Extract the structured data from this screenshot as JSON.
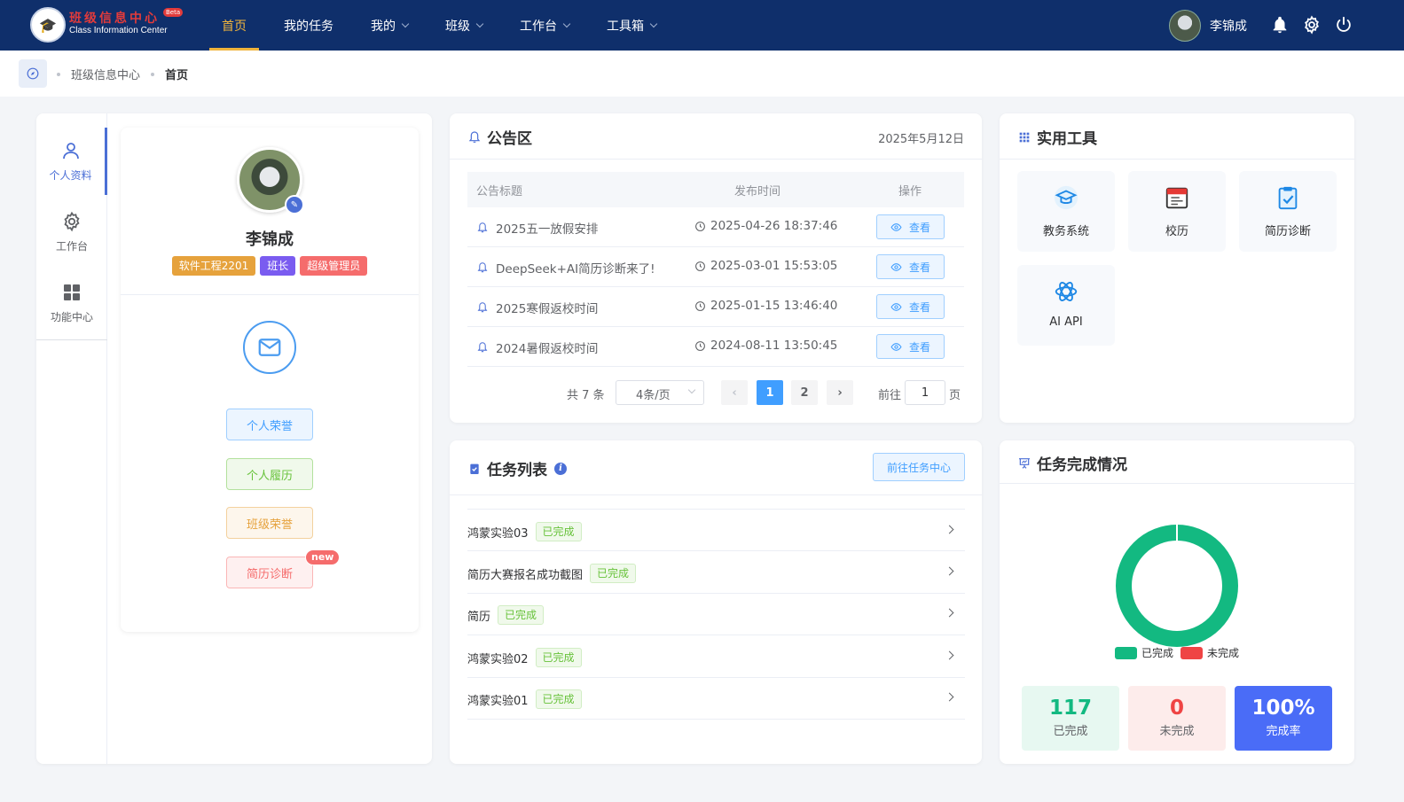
{
  "brand": {
    "cn": "班级信息中心",
    "en": "Class Information Center",
    "badge": "Beta"
  },
  "nav": [
    {
      "label": "首页",
      "active": true,
      "dropdown": false
    },
    {
      "label": "我的任务",
      "active": false,
      "dropdown": false
    },
    {
      "label": "我的",
      "active": false,
      "dropdown": true
    },
    {
      "label": "班级",
      "active": false,
      "dropdown": true
    },
    {
      "label": "工作台",
      "active": false,
      "dropdown": true
    },
    {
      "label": "工具箱",
      "active": false,
      "dropdown": true
    }
  ],
  "user": {
    "name": "李锦成"
  },
  "header_icons": [
    "bell-icon",
    "gear-icon",
    "power-icon"
  ],
  "breadcrumb": {
    "items": [
      "班级信息中心",
      "首页"
    ]
  },
  "sidebar": {
    "tabs": [
      {
        "label": "个人资料",
        "icon": "user-icon",
        "active": true
      },
      {
        "label": "工作台",
        "icon": "gear-icon",
        "active": false
      },
      {
        "label": "功能中心",
        "icon": "grid-icon",
        "active": false
      }
    ]
  },
  "profile": {
    "name": "李锦成",
    "tags": [
      {
        "label": "软件工程2201",
        "color": "#e6a23c"
      },
      {
        "label": "班长",
        "color": "#7a5cf0"
      },
      {
        "label": "超级管理员",
        "color": "#f56c6c"
      }
    ],
    "buttons": [
      "个人荣誉",
      "个人履历",
      "班级荣誉",
      "简历诊断"
    ],
    "new_badge": "new"
  },
  "announcements": {
    "title": "公告区",
    "date": "2025年5月12日",
    "columns": [
      "公告标题",
      "发布时间",
      "操作"
    ],
    "rows": [
      {
        "title": "2025五一放假安排",
        "time": "2025-04-26 18:37:46",
        "action": "查看"
      },
      {
        "title": "DeepSeek+AI简历诊断来了!",
        "time": "2025-03-01 15:53:05",
        "action": "查看"
      },
      {
        "title": "2025寒假返校时间",
        "time": "2025-01-15 13:46:40",
        "action": "查看"
      },
      {
        "title": "2024暑假返校时间",
        "time": "2024-08-11 13:50:45",
        "action": "查看"
      }
    ],
    "pager": {
      "total": "共 7 条",
      "page_size": "4条/页",
      "pages": [
        "1",
        "2"
      ],
      "current": "1",
      "goto_label": "前往",
      "goto_value": "1",
      "page_suffix": "页"
    }
  },
  "tools": {
    "title": "实用工具",
    "items": [
      {
        "label": "教务系统",
        "icon": "graduation-cap-icon"
      },
      {
        "label": "校历",
        "icon": "calendar-icon"
      },
      {
        "label": "简历诊断",
        "icon": "clipboard-check-icon"
      },
      {
        "label": "AI API",
        "icon": "openai-icon"
      }
    ]
  },
  "tasks": {
    "title": "任务列表",
    "go_label": "前往任务中心",
    "items": [
      {
        "name": "鸿蒙实验03",
        "status": "已完成"
      },
      {
        "name": "简历大赛报名成功截图",
        "status": "已完成"
      },
      {
        "name": "简历",
        "status": "已完成"
      },
      {
        "name": "鸿蒙实验02",
        "status": "已完成"
      },
      {
        "name": "鸿蒙实验01",
        "status": "已完成"
      }
    ]
  },
  "completion": {
    "title": "任务完成情况",
    "legend": [
      {
        "label": "已完成",
        "color": "#13b981"
      },
      {
        "label": "未完成",
        "color": "#ef4444"
      }
    ],
    "stats": [
      {
        "value": "117",
        "label": "已完成",
        "color": "#13b981",
        "bg": "#e7f8f1"
      },
      {
        "value": "0",
        "label": "未完成",
        "color": "#ef4444",
        "bg": "#fdeceb"
      },
      {
        "value": "100%",
        "label": "完成率",
        "color": "#ffffff",
        "bg": "#4a6cf7"
      }
    ],
    "chart_data": {
      "type": "pie",
      "categories": [
        "已完成",
        "未完成"
      ],
      "values": [
        117,
        0
      ]
    }
  }
}
